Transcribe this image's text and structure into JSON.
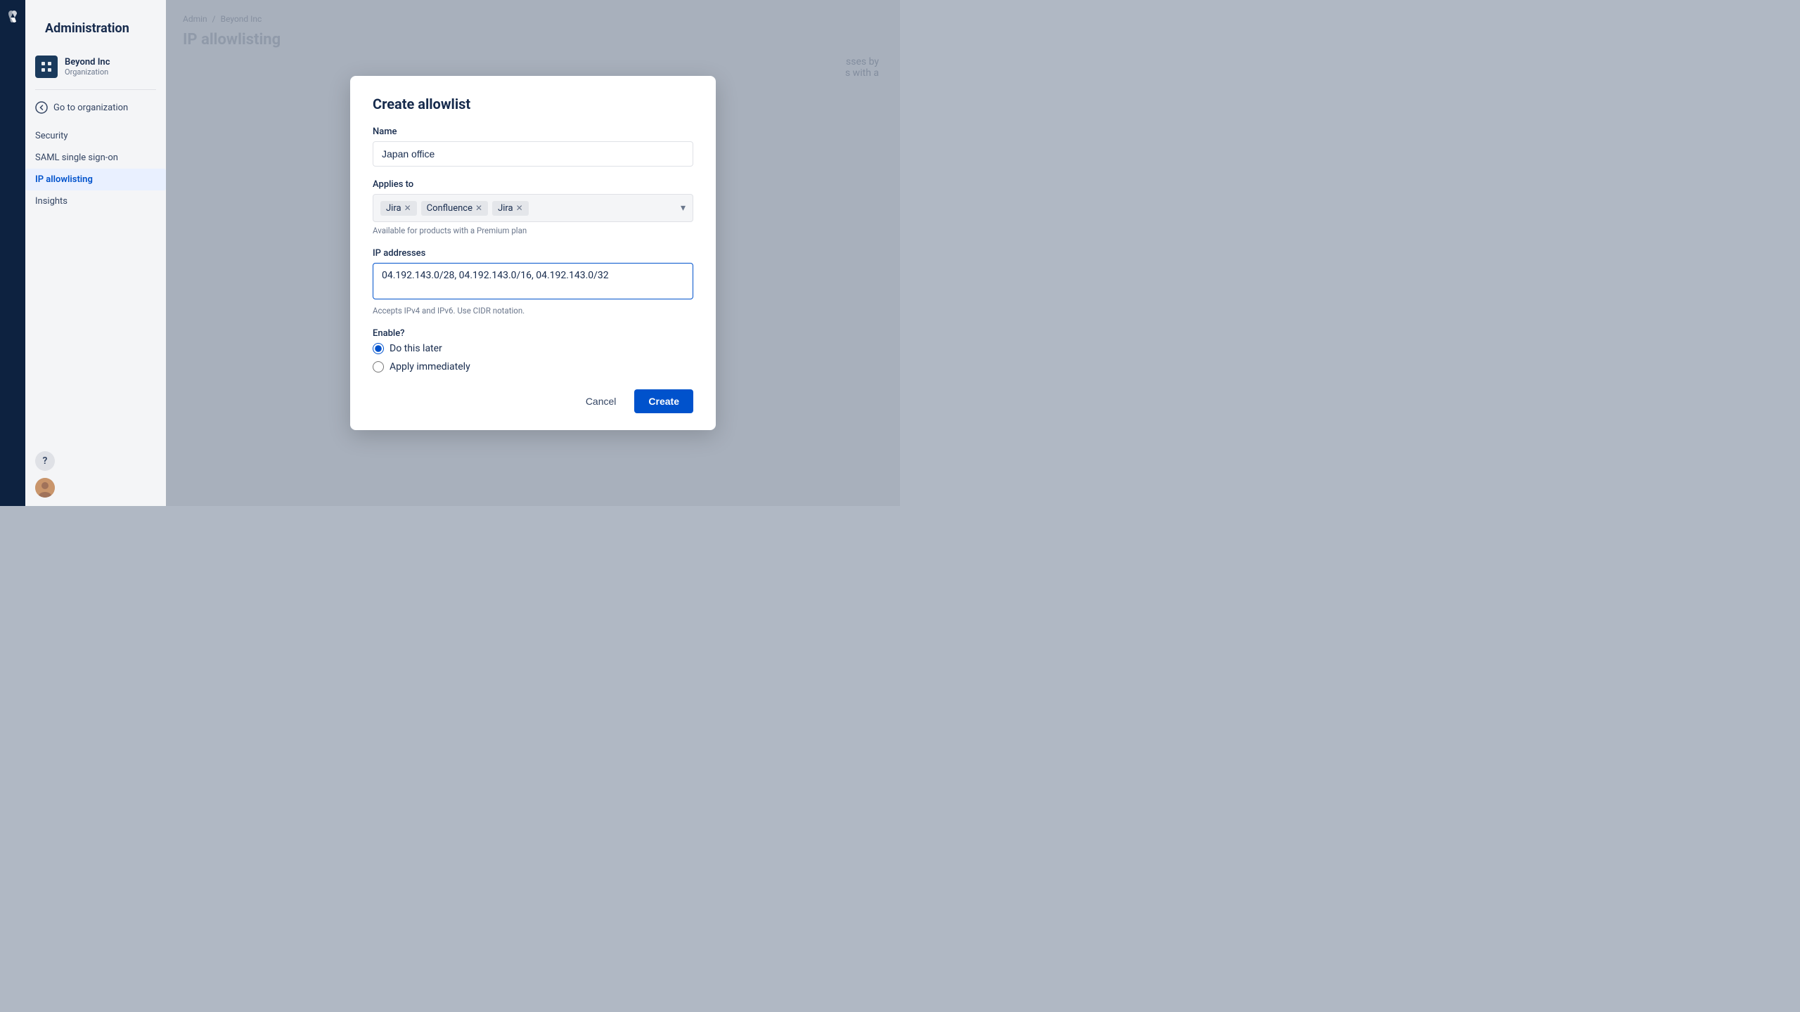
{
  "app": {
    "logo_label": "Atlassian",
    "admin_title": "Administration"
  },
  "sidebar": {
    "org_name": "Beyond Inc",
    "org_type": "Organization",
    "go_to_org": "Go to organization",
    "nav_items": [
      {
        "id": "security",
        "label": "Security",
        "active": false
      },
      {
        "id": "saml",
        "label": "SAML single sign-on",
        "active": false
      },
      {
        "id": "ip-allowlisting",
        "label": "IP allowlisting",
        "active": true
      },
      {
        "id": "insights",
        "label": "Insights",
        "active": false
      }
    ]
  },
  "breadcrumb": {
    "admin": "Admin",
    "separator": "/",
    "org": "Beyond Inc"
  },
  "page": {
    "title": "IP allowlisting",
    "bg_text_1": "sses by",
    "bg_text_2": "s with a"
  },
  "modal": {
    "title": "Create allowlist",
    "name_label": "Name",
    "name_value": "Japan office",
    "name_placeholder": "Japan office",
    "applies_to_label": "Applies to",
    "tags": [
      {
        "label": "Jira"
      },
      {
        "label": "Confluence"
      },
      {
        "label": "Jira"
      }
    ],
    "applies_hint": "Available for products with a Premium plan",
    "ip_label": "IP addresses",
    "ip_value": "04.192.143.0/28, 04.192.143.0/16, 04.192.143.0/32",
    "ip_placeholder": "04.192.143.0/28, 04.192.143.0/16, 04.192.143.0/32",
    "ip_hint": "Accepts IPv4 and IPv6. Use CIDR notation.",
    "enable_label": "Enable?",
    "radio_options": [
      {
        "id": "do-later",
        "label": "Do this later",
        "checked": true
      },
      {
        "id": "apply-immediately",
        "label": "Apply immediately",
        "checked": false
      }
    ],
    "cancel_label": "Cancel",
    "create_label": "Create"
  },
  "bottom_nav": {
    "help_char": "?"
  }
}
